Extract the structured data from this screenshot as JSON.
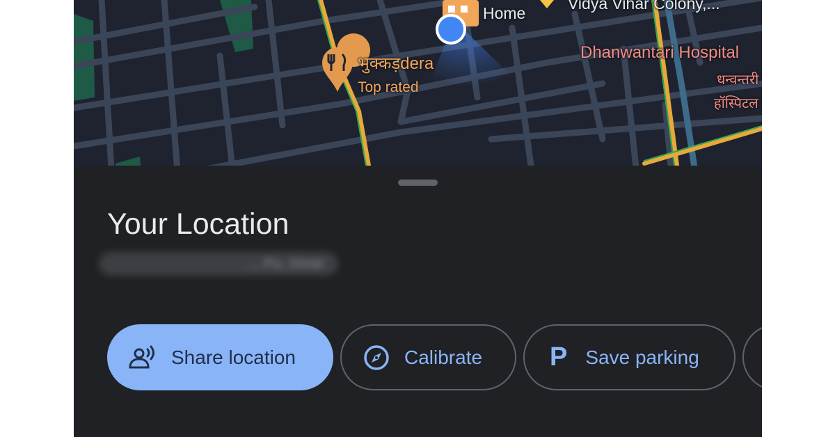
{
  "map": {
    "labels": {
      "home": "Home",
      "colony": "Vidya Vihar Colony,...",
      "restaurant_name": "भुक्कड़dera",
      "restaurant_tag": "Top rated",
      "hospital_en": "Dhanwantari Hospital",
      "hospital_hi_line1": "धन्वन्तरी",
      "hospital_hi_line2": "हॉस्पिटल"
    },
    "icons": {
      "user_location": "blue-dot-icon",
      "restaurant": "fork-knife-pin-icon",
      "home": "home-icon"
    }
  },
  "sheet": {
    "title": "Your Location",
    "address": "... Pu, 2nnar"
  },
  "actions": {
    "share_label": "Share location",
    "calibrate_label": "Calibrate",
    "parking_label": "Save parking",
    "parking_glyph": "P"
  },
  "colors": {
    "map_background": "#1f2330",
    "road": "#3b4558",
    "park": "#1e5a46",
    "sheet_background": "#202124",
    "accent": "#8ab4f8",
    "location_dot": "#4285f4",
    "poi_orange": "#f2a65a",
    "hospital_red": "#f28b82",
    "major_road": "#e8a93b",
    "traffic_green": "#34a853"
  }
}
